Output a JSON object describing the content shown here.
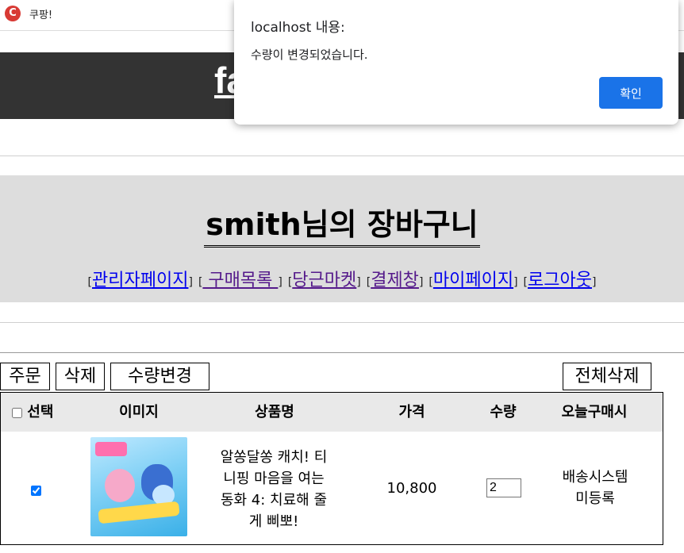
{
  "browser": {
    "tab_title": "쿠팡!",
    "favicon_letter": "C"
  },
  "header": {
    "logo_text": "fa"
  },
  "cart": {
    "title": "smith님의 장바구니",
    "nav": [
      {
        "label": "관리자페이지"
      },
      {
        "label": " 구매목록 "
      },
      {
        "label": "당근마켓"
      },
      {
        "label": "결제창"
      },
      {
        "label": "마이페이지"
      },
      {
        "label": "로그아웃"
      }
    ]
  },
  "actions": {
    "order": "주문",
    "delete": "삭제",
    "change_qty": "수량변경",
    "delete_all": "전체삭제"
  },
  "table": {
    "headers": {
      "select": "선택",
      "image": "이미지",
      "name": "상품명",
      "price": "가격",
      "quantity": "수량",
      "today": "오늘구매시"
    },
    "rows": [
      {
        "selected": true,
        "name_lines": [
          "알쏭달쏭 캐치! 티",
          "니핑 마음을 여는",
          "동화 4: 치료해 줄",
          "게 삐뽀!"
        ],
        "price": "10,800",
        "quantity": "2",
        "delivery_lines": [
          "배송시스템",
          "미등록"
        ]
      }
    ]
  },
  "dialog": {
    "origin": "localhost 내용:",
    "message": "수량이 변경되었습니다.",
    "ok_label": "확인"
  },
  "colors": {
    "header_bg": "#333333",
    "band_bg": "#dddddd",
    "dialog_button": "#1a73e8",
    "link": "#0000ee",
    "link_visited": "#551a8b"
  }
}
